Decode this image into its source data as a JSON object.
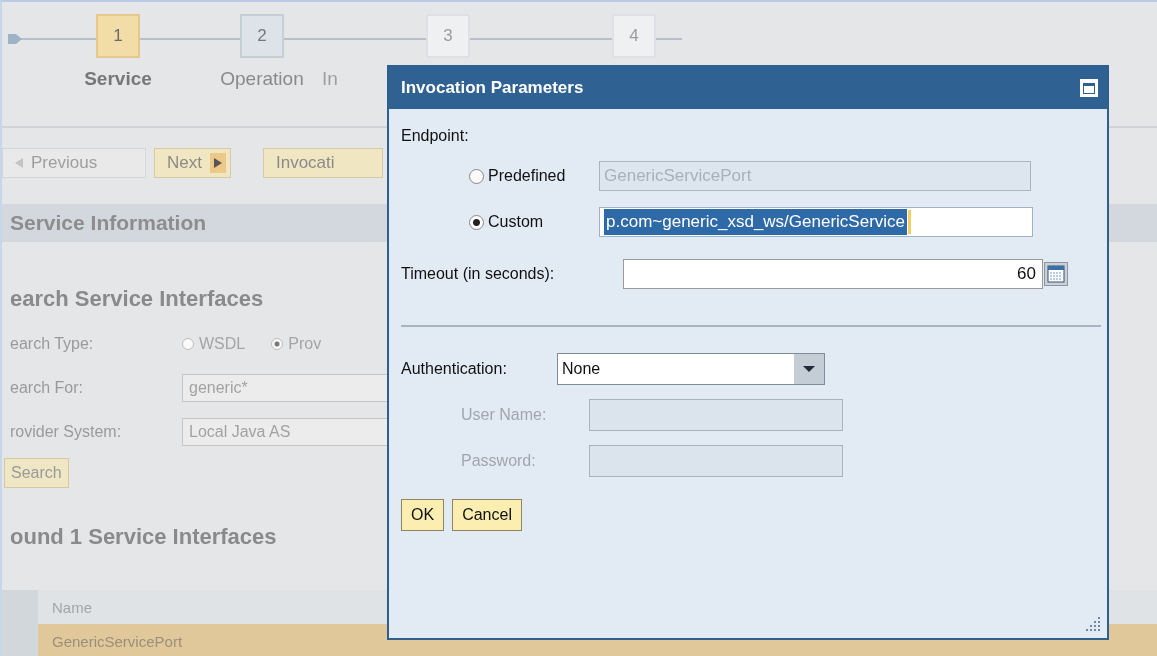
{
  "steps": [
    {
      "number": "1",
      "label": "Service",
      "selected": true,
      "disabled": false
    },
    {
      "number": "2",
      "label": "Operation",
      "selected": false,
      "disabled": false
    },
    {
      "number": "3",
      "label": "In",
      "selected": false,
      "disabled": true
    },
    {
      "number": "4",
      "selected": false,
      "disabled": true
    }
  ],
  "nav_buttons": [
    {
      "label": "Previous",
      "kind": "prev",
      "disabled": true
    },
    {
      "label": "Next",
      "kind": "next",
      "disabled": false
    },
    {
      "label": "Invocati",
      "kind": "plain",
      "disabled": false
    }
  ],
  "section_title": "Service Information",
  "search": {
    "title": "earch Service Interfaces",
    "type_label": "earch Type:",
    "type_options": [
      {
        "label": "WSDL",
        "selected": false
      },
      {
        "label": "Prov",
        "selected": true
      }
    ],
    "for_label": "earch For:",
    "for_value": "generic*",
    "provider_label": "rovider System:",
    "provider_value": "Local Java AS",
    "button": "Search"
  },
  "results": {
    "title": "ound 1 Service Interfaces",
    "columns": [
      "Name"
    ],
    "rows": [
      {
        "name": "GenericServicePort",
        "selected": true
      }
    ]
  },
  "dialog": {
    "title": "Invocation Parameters",
    "endpoint_label": "Endpoint:",
    "endpoint_options": [
      {
        "label": "Predefined",
        "selected": false,
        "value": "GenericServicePort",
        "disabled": true,
        "highlighted": false
      },
      {
        "label": "Custom",
        "selected": true,
        "value": "p.com~generic_xsd_ws/GenericService",
        "disabled": false,
        "highlighted": true
      }
    ],
    "timeout_label": "Timeout (in seconds):",
    "timeout_value": "60",
    "auth_label": "Authentication:",
    "auth_value": "None",
    "credentials": [
      {
        "label": "User Name:",
        "disabled": true
      },
      {
        "label": "Password:",
        "disabled": true
      }
    ],
    "buttons": [
      "OK",
      "Cancel"
    ]
  }
}
